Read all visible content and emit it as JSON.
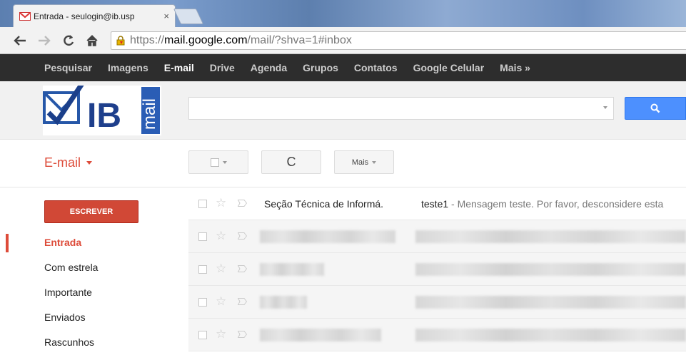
{
  "browser": {
    "tab_title": "Entrada - seulogin@ib.usp",
    "tab_close": "×",
    "url_prefix": "https://",
    "url_host": "mail.google.com",
    "url_path": "/mail/?shva=1#inbox"
  },
  "gbar": {
    "items": [
      "Pesquisar",
      "Imagens",
      "E-mail",
      "Drive",
      "Agenda",
      "Grupos",
      "Contatos",
      "Google Celular",
      "Mais »"
    ],
    "active_index": 2
  },
  "logo": {
    "text": "IB",
    "sub": "mail"
  },
  "toolbar": {
    "section_label": "E-mail",
    "more_label": "Mais",
    "refresh_glyph": "C"
  },
  "compose_label": "ESCREVER",
  "nav": {
    "items": [
      "Entrada",
      "Com estrela",
      "Importante",
      "Enviados",
      "Rascunhos"
    ],
    "active_index": 0
  },
  "messages": [
    {
      "sender": "Seção Técnica de Informá.",
      "subject": "teste1",
      "snippet": " - Mensagem teste. Por favor, desconsidere esta"
    }
  ],
  "colors": {
    "accent": "#dd4b39",
    "compose": "#d14836",
    "search": "#4d90fe",
    "gbar": "#2d2d2d"
  }
}
